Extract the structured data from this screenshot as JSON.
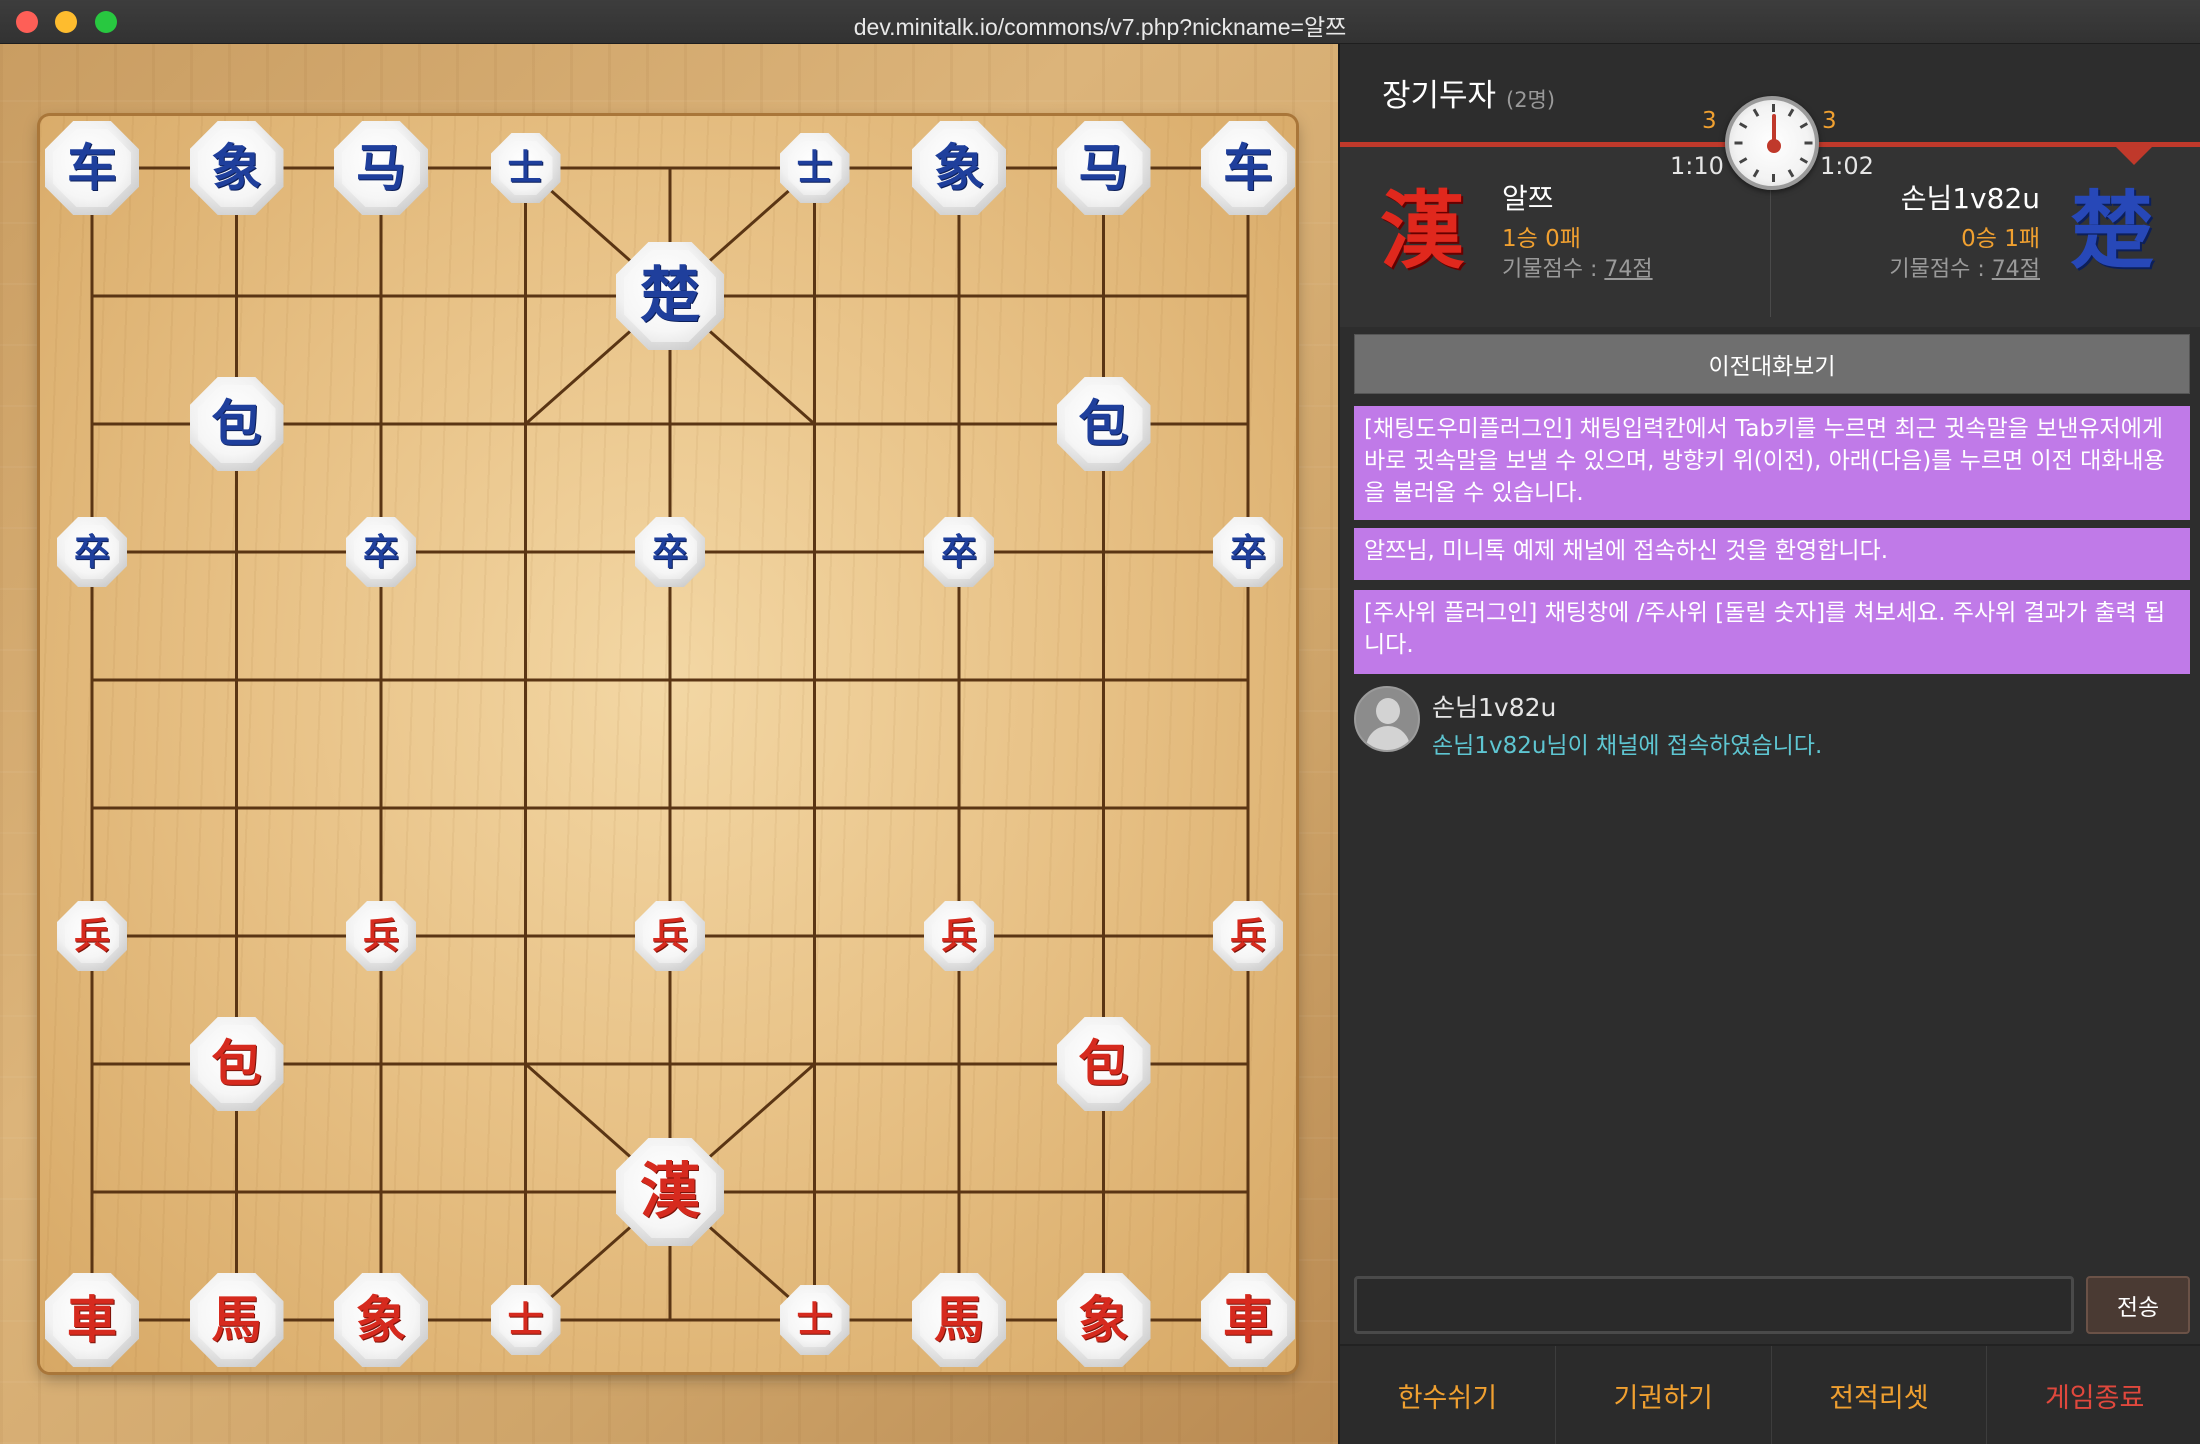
{
  "window": {
    "title": "dev.minitalk.io/commons/v7.php?nickname=알쯔"
  },
  "board": {
    "pieces": [
      {
        "char": "车",
        "side": "blue",
        "col": 0,
        "row": 0,
        "size": "normal",
        "name": "blue-chariot-1"
      },
      {
        "char": "象",
        "side": "blue",
        "col": 1,
        "row": 0,
        "size": "normal",
        "name": "blue-elephant-1"
      },
      {
        "char": "马",
        "side": "blue",
        "col": 2,
        "row": 0,
        "size": "normal",
        "name": "blue-horse-1"
      },
      {
        "char": "士",
        "side": "blue",
        "col": 3,
        "row": 0,
        "size": "small",
        "name": "blue-guard-1"
      },
      {
        "char": "士",
        "side": "blue",
        "col": 5,
        "row": 0,
        "size": "small",
        "name": "blue-guard-2"
      },
      {
        "char": "象",
        "side": "blue",
        "col": 6,
        "row": 0,
        "size": "normal",
        "name": "blue-elephant-2"
      },
      {
        "char": "马",
        "side": "blue",
        "col": 7,
        "row": 0,
        "size": "normal",
        "name": "blue-horse-2"
      },
      {
        "char": "车",
        "side": "blue",
        "col": 8,
        "row": 0,
        "size": "normal",
        "name": "blue-chariot-2"
      },
      {
        "char": "楚",
        "side": "blue",
        "col": 4,
        "row": 1,
        "size": "large",
        "name": "blue-general"
      },
      {
        "char": "包",
        "side": "blue",
        "col": 1,
        "row": 2,
        "size": "normal",
        "name": "blue-cannon-1"
      },
      {
        "char": "包",
        "side": "blue",
        "col": 7,
        "row": 2,
        "size": "normal",
        "name": "blue-cannon-2"
      },
      {
        "char": "卒",
        "side": "blue",
        "col": 0,
        "row": 3,
        "size": "small",
        "name": "blue-soldier-1"
      },
      {
        "char": "卒",
        "side": "blue",
        "col": 2,
        "row": 3,
        "size": "small",
        "name": "blue-soldier-2"
      },
      {
        "char": "卒",
        "side": "blue",
        "col": 4,
        "row": 3,
        "size": "small",
        "name": "blue-soldier-3"
      },
      {
        "char": "卒",
        "side": "blue",
        "col": 6,
        "row": 3,
        "size": "small",
        "name": "blue-soldier-4"
      },
      {
        "char": "卒",
        "side": "blue",
        "col": 8,
        "row": 3,
        "size": "small",
        "name": "blue-soldier-5"
      },
      {
        "char": "兵",
        "side": "red",
        "col": 0,
        "row": 6,
        "size": "small",
        "name": "red-soldier-1"
      },
      {
        "char": "兵",
        "side": "red",
        "col": 2,
        "row": 6,
        "size": "small",
        "name": "red-soldier-2"
      },
      {
        "char": "兵",
        "side": "red",
        "col": 4,
        "row": 6,
        "size": "small",
        "name": "red-soldier-3"
      },
      {
        "char": "兵",
        "side": "red",
        "col": 6,
        "row": 6,
        "size": "small",
        "name": "red-soldier-4"
      },
      {
        "char": "兵",
        "side": "red",
        "col": 8,
        "row": 6,
        "size": "small",
        "name": "red-soldier-5"
      },
      {
        "char": "包",
        "side": "red",
        "col": 1,
        "row": 7,
        "size": "normal",
        "name": "red-cannon-1"
      },
      {
        "char": "包",
        "side": "red",
        "col": 7,
        "row": 7,
        "size": "normal",
        "name": "red-cannon-2"
      },
      {
        "char": "漢",
        "side": "red",
        "col": 4,
        "row": 8,
        "size": "large",
        "name": "red-general"
      },
      {
        "char": "車",
        "side": "red",
        "col": 0,
        "row": 9,
        "size": "normal",
        "name": "red-chariot-1"
      },
      {
        "char": "馬",
        "side": "red",
        "col": 1,
        "row": 9,
        "size": "normal",
        "name": "red-horse-1"
      },
      {
        "char": "象",
        "side": "red",
        "col": 2,
        "row": 9,
        "size": "normal",
        "name": "red-elephant-1"
      },
      {
        "char": "士",
        "side": "red",
        "col": 3,
        "row": 9,
        "size": "small",
        "name": "red-guard-1"
      },
      {
        "char": "士",
        "side": "red",
        "col": 5,
        "row": 9,
        "size": "small",
        "name": "red-guard-2"
      },
      {
        "char": "馬",
        "side": "red",
        "col": 6,
        "row": 9,
        "size": "normal",
        "name": "red-horse-2"
      },
      {
        "char": "象",
        "side": "red",
        "col": 7,
        "row": 9,
        "size": "normal",
        "name": "red-elephant-2"
      },
      {
        "char": "車",
        "side": "red",
        "col": 8,
        "row": 9,
        "size": "normal",
        "name": "red-chariot-2"
      }
    ]
  },
  "panel": {
    "room_title": "장기두자",
    "room_count": "(2명)",
    "clock": {
      "left_count": "3",
      "right_count": "3",
      "left_time": "1:10",
      "right_time": "1:02"
    },
    "player_left": {
      "icon": "漢",
      "name": "알쯔",
      "record": "1승 0패",
      "score_label": "기물점수 : ",
      "score_value": "74점"
    },
    "player_right": {
      "icon": "楚",
      "name": "손님1v82u",
      "record": "0승 1패",
      "score_label": "기물점수 : ",
      "score_value": "74점"
    },
    "history_button": "이전대화보기",
    "notices": [
      "[채팅도우미플러그인] 채팅입력칸에서 Tab키를 누르면 최근 귓속말을 보낸유저에게 바로 귓속말을 보낼 수 있으며, 방향키 위(이전), 아래(다음)를 누르면 이전 대화내용을 불러올 수 있습니다.",
      "알쯔님, 미니톡 예제 채널에 접속하신 것을 환영합니다.",
      "[주사위 플러그인] 채팅창에 /주사위 [돌릴 숫자]를 쳐보세요. 주사위 결과가 출력 됩니다."
    ],
    "chat": {
      "user": "손님1v82u",
      "message": "손님1v82u님이 채널에 접속하였습니다."
    },
    "input": {
      "value": "",
      "placeholder": ""
    },
    "send_button": "전송",
    "bottom_buttons": [
      "한수쉬기",
      "기권하기",
      "전적리셋",
      "게임종료"
    ]
  }
}
